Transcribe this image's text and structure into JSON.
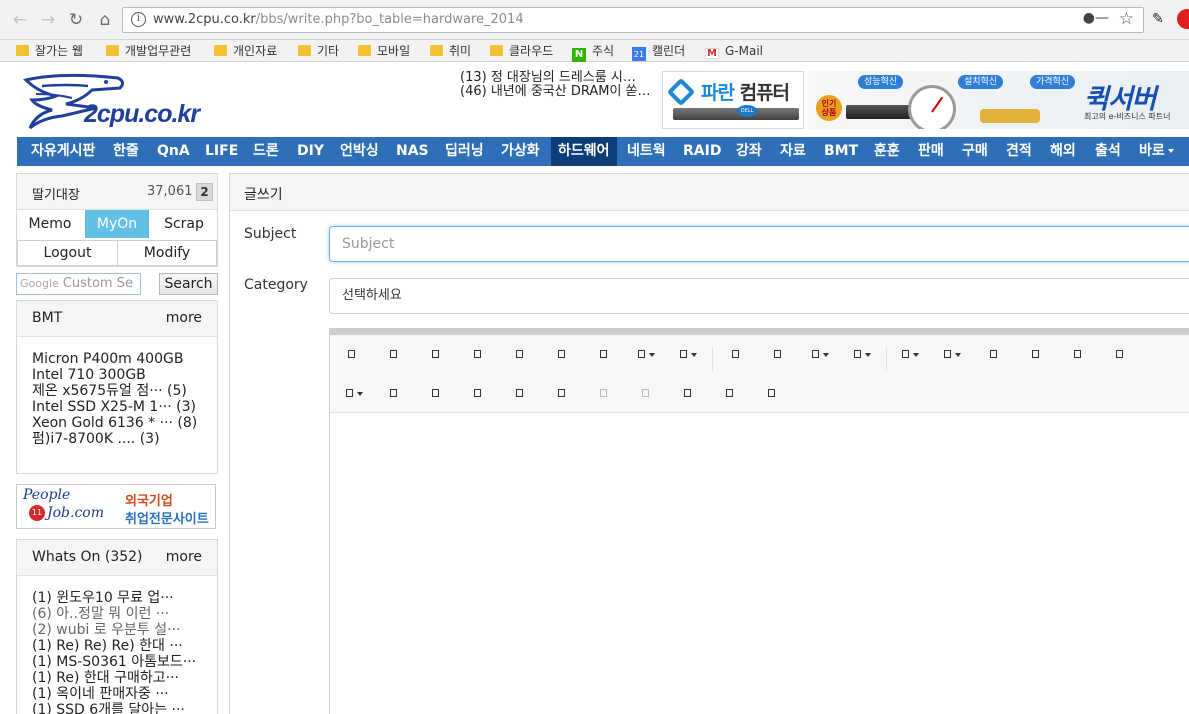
{
  "browser": {
    "url_host": "www.2cpu.co.kr",
    "url_path": "/bbs/write.php?bo_table=hardware_2014",
    "bookmarks": [
      {
        "label": "잘가는 웹",
        "icon": "folder-icon"
      },
      {
        "label": "개발업무관련",
        "icon": "folder-icon"
      },
      {
        "label": "개인자료",
        "icon": "folder-icon"
      },
      {
        "label": "기타",
        "icon": "folder-icon"
      },
      {
        "label": "모바일",
        "icon": "folder-icon"
      },
      {
        "label": "취미",
        "icon": "folder-icon"
      },
      {
        "label": "클라우드",
        "icon": "folder-icon"
      },
      {
        "label": "주식",
        "icon": "naver-icon"
      },
      {
        "label": "캘린더",
        "icon": "calendar-icon"
      },
      {
        "label": "G-Mail",
        "icon": "gmail-icon"
      }
    ],
    "calendar_icon_text": "21",
    "naver_icon_text": "N",
    "gmail_icon_text": "M"
  },
  "header": {
    "logo_text": "2cpu.co.kr",
    "news": [
      "(13) 정 대장님의 드레스룸 시…",
      "(46) 내년에 중국산 DRAM이 쏟…"
    ],
    "banner_pc": {
      "blue": "파란",
      "dark": "컴퓨터",
      "dell": "DELL"
    },
    "banner_q": {
      "tags": [
        "성능혁신",
        "설치혁신",
        "가격혁신"
      ],
      "badge": "인기\n상품",
      "title": "퀵서버",
      "sub": "최고의 e-비즈니스 파트너"
    }
  },
  "nav": {
    "items": [
      "자유게시판",
      "한줄",
      "QnA",
      "LIFE",
      "드론",
      "DIY",
      "언박싱",
      "NAS",
      "딥러닝",
      "가상화",
      "하드웨어",
      "네트웍",
      "RAID",
      "강좌",
      "자료",
      "BMT",
      "훈훈",
      "판매",
      "구매",
      "견적",
      "해외",
      "출석",
      "바로"
    ],
    "active": "하드웨어",
    "colors": {
      "bar": "#2e6fb7",
      "active": "#0d3d78"
    }
  },
  "user": {
    "name": "딸기대장",
    "points": "37,061",
    "badge": "2",
    "tabs": [
      "Memo",
      "MyOn",
      "Scrap"
    ],
    "active_tab": "MyOn",
    "logout": "Logout",
    "modify": "Modify"
  },
  "search": {
    "google": "Google",
    "placeholder": "Custom Se",
    "button": "Search"
  },
  "bmt": {
    "title": "BMT",
    "more": "more",
    "items": [
      "Micron P400m 400GB",
      "Intel 710 300GB",
      "제온 x5675듀얼 점··· (5)",
      "Intel SSD X25-M 1··· (3)",
      "Xeon Gold 6136 * ··· (8)",
      "펌)i7-8700K .... (3)"
    ]
  },
  "ad_people": {
    "people": "People",
    "num": "11",
    "job": "Job.com",
    "line1": "외국기업",
    "line2": "취업전문사이트"
  },
  "whatson": {
    "title": "Whats On (352)",
    "more": "more",
    "items": [
      "(1) 윈도우10 무료 업···",
      "(6) 아..정말 뭐 이런 ···",
      "(2) wubi 로 우분투 설···",
      "(1) Re) Re) Re) 한대 ···",
      "(1) MS-S0361 아톰보드···",
      "(1) Re) 한대 구매하고···",
      "(1) 옥이네 판매자중 ···",
      "(1) SSD 6개를 달아는 ···"
    ],
    "gray_items": [
      1,
      2
    ]
  },
  "write": {
    "title": "글쓰기",
    "subject_label": "Subject",
    "subject_placeholder": "Subject",
    "category_label": "Category",
    "category_value": "선택하세요",
    "accent": "#66afe9"
  }
}
